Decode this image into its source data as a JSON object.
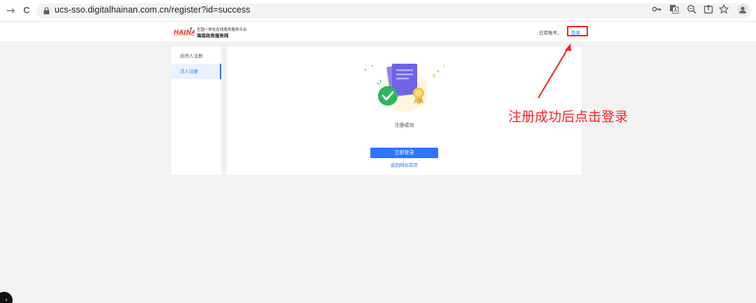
{
  "browser": {
    "url": "ucs-sso.digitalhainan.com.cn/register?id=success",
    "back_glyph": "→",
    "reload_glyph": "C",
    "toolbar_icons": [
      "key-icon",
      "translate-icon",
      "zoom-icon",
      "share-icon",
      "star-icon",
      "profile-icon"
    ]
  },
  "header": {
    "logo_text": "HAINAN",
    "logo_subtitle_1": "全国一体化在线政务服务平台",
    "logo_subtitle_2": "海南政务服务网",
    "have_account": "已有账号，",
    "login_link": "登录"
  },
  "sidebar": {
    "items": [
      {
        "label": "自然人注册"
      },
      {
        "label": "法人注册"
      }
    ]
  },
  "main": {
    "success_text": "注册成功",
    "login_button": "立即登录",
    "back_link": "返回网站首页"
  },
  "annotation": {
    "text": "注册成功后点击登录"
  },
  "colors": {
    "accent": "#2f74ff",
    "annotation": "#ff2020",
    "success": "#2db55d"
  }
}
